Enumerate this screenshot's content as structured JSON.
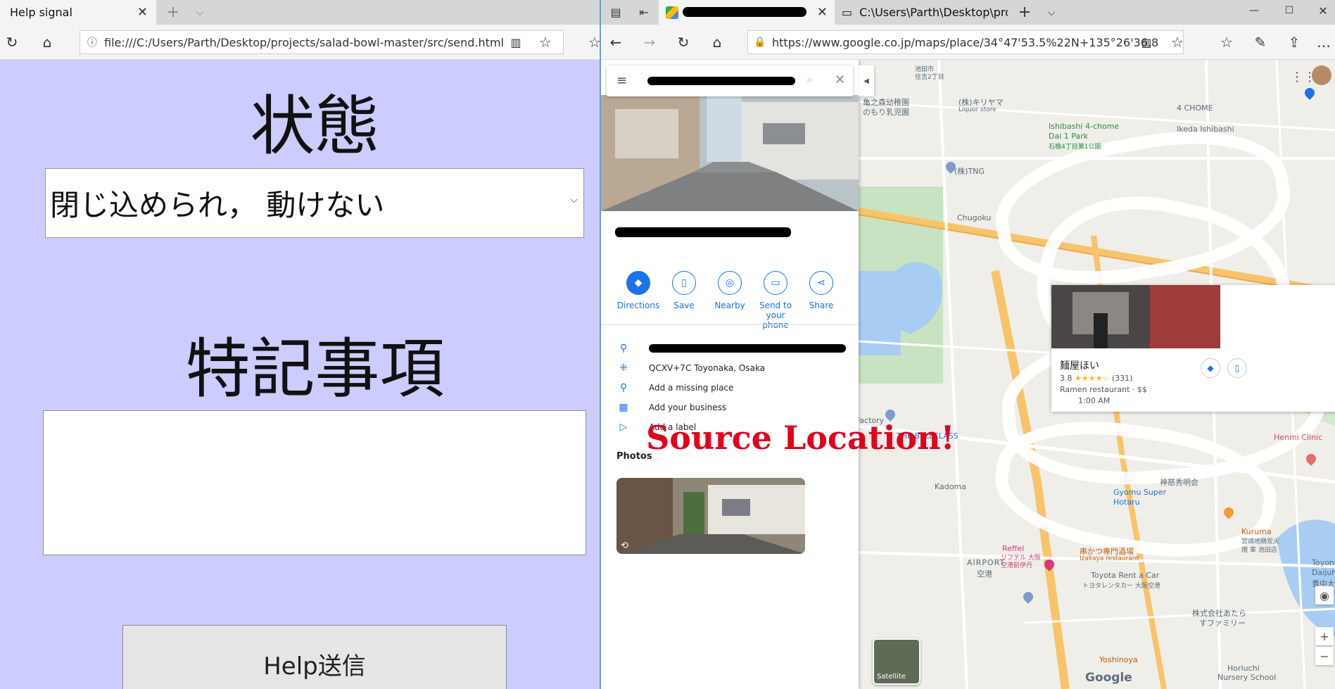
{
  "left_browser": {
    "tab_title": "Help signal",
    "address": "file:///C:/Users/Parth/Desktop/projects/salad-bowl-master/src/send.html"
  },
  "form": {
    "status_heading": "状態",
    "status_value": "閉じ込められ， 動けない",
    "notes_heading": "特記事項",
    "notes_value": "",
    "submit_label": "Help送信"
  },
  "right_browser": {
    "tab2_title": "C:\\Users\\Parth\\Desktop\\pro",
    "address": "https://www.google.co.jp/maps/place/34°47'53.5%22N+135°26'36.8"
  },
  "place_panel": {
    "actions": [
      {
        "label": "Directions"
      },
      {
        "label": "Save"
      },
      {
        "label": "Nearby"
      },
      {
        "label": "Send to your",
        "label2": "phone"
      },
      {
        "label": "Share"
      }
    ],
    "plus_code": "QCXV+7C Toyonaka, Osaka",
    "add_missing_place": "Add a missing place",
    "add_business": "Add your business",
    "add_label": "Add a label",
    "photos_heading": "Photos"
  },
  "map": {
    "annotation": "Source Location!",
    "labels": {
      "ikeda_ishibashi": "Ikeda Ishibashi",
      "chome4": "4 CHOME",
      "ishibashi_park_1": "Ishibashi 4-chome",
      "ishibashi_park_2": "Dai 1 Park",
      "ishibashi_park_3": "石橋4丁目第1公園",
      "tng": "(株)TNG",
      "chugoku": "Chugoku",
      "liquor_1": "(株)キリヤマ",
      "liquor_2": "Liquor store",
      "nursery_1": "亀之森幼稚園",
      "nursery_2": "のもり乳児園",
      "ikeda_shi": "池田市",
      "sumiyoshi": "住吉2丁目",
      "bellclass": "THE BELLCLASS",
      "factory": "Factory",
      "kadoma": "Kadoma",
      "gyomu_super": "Gyomu Super",
      "hotaru": "Hotaru",
      "airport": "AIRPORT",
      "airport_kanji": "空港",
      "kushikatsu_1": "串かつ専門酒場",
      "kushikatsu_2": "Izakaya restaurant",
      "kurume_1": "Kuruma",
      "kurume_2": "宮崎地鶏炭火",
      "kurume_3": "焼 車 池田店",
      "toyota_1": "Toyota Rent a Car",
      "toyota_2": "トヨタレンタカー 大阪空港",
      "yoshinoya": "Yoshinoya",
      "horiuchi_1": "Horiuchi",
      "horiuchi_2": "Nursery School",
      "family_1": "株式会社あたら",
      "family_2": "すファミリー",
      "toyonaka_1": "Toyona",
      "toyonaka_2": "Daijuha",
      "toyonaka_3": "豊中大",
      "henmi": "Henmi Clinic",
      "jinja": "神慈秀明会",
      "reffel_1": "Reffel",
      "reffel_2": "リフテル 大阪",
      "reffel_3": "空港前伊丹",
      "satellite": "Satellite",
      "google": "Google"
    },
    "result_card": {
      "name": "麺屋ほい",
      "rating": "3.8",
      "stars": "★★★★☆",
      "reviews": "(331)",
      "category": "Ramen restaurant · $$",
      "hours": "1:00 AM"
    }
  },
  "colors": {
    "left_bg": "#ccccff",
    "annotation": "#e3001b",
    "google_blue": "#1a73e8"
  }
}
